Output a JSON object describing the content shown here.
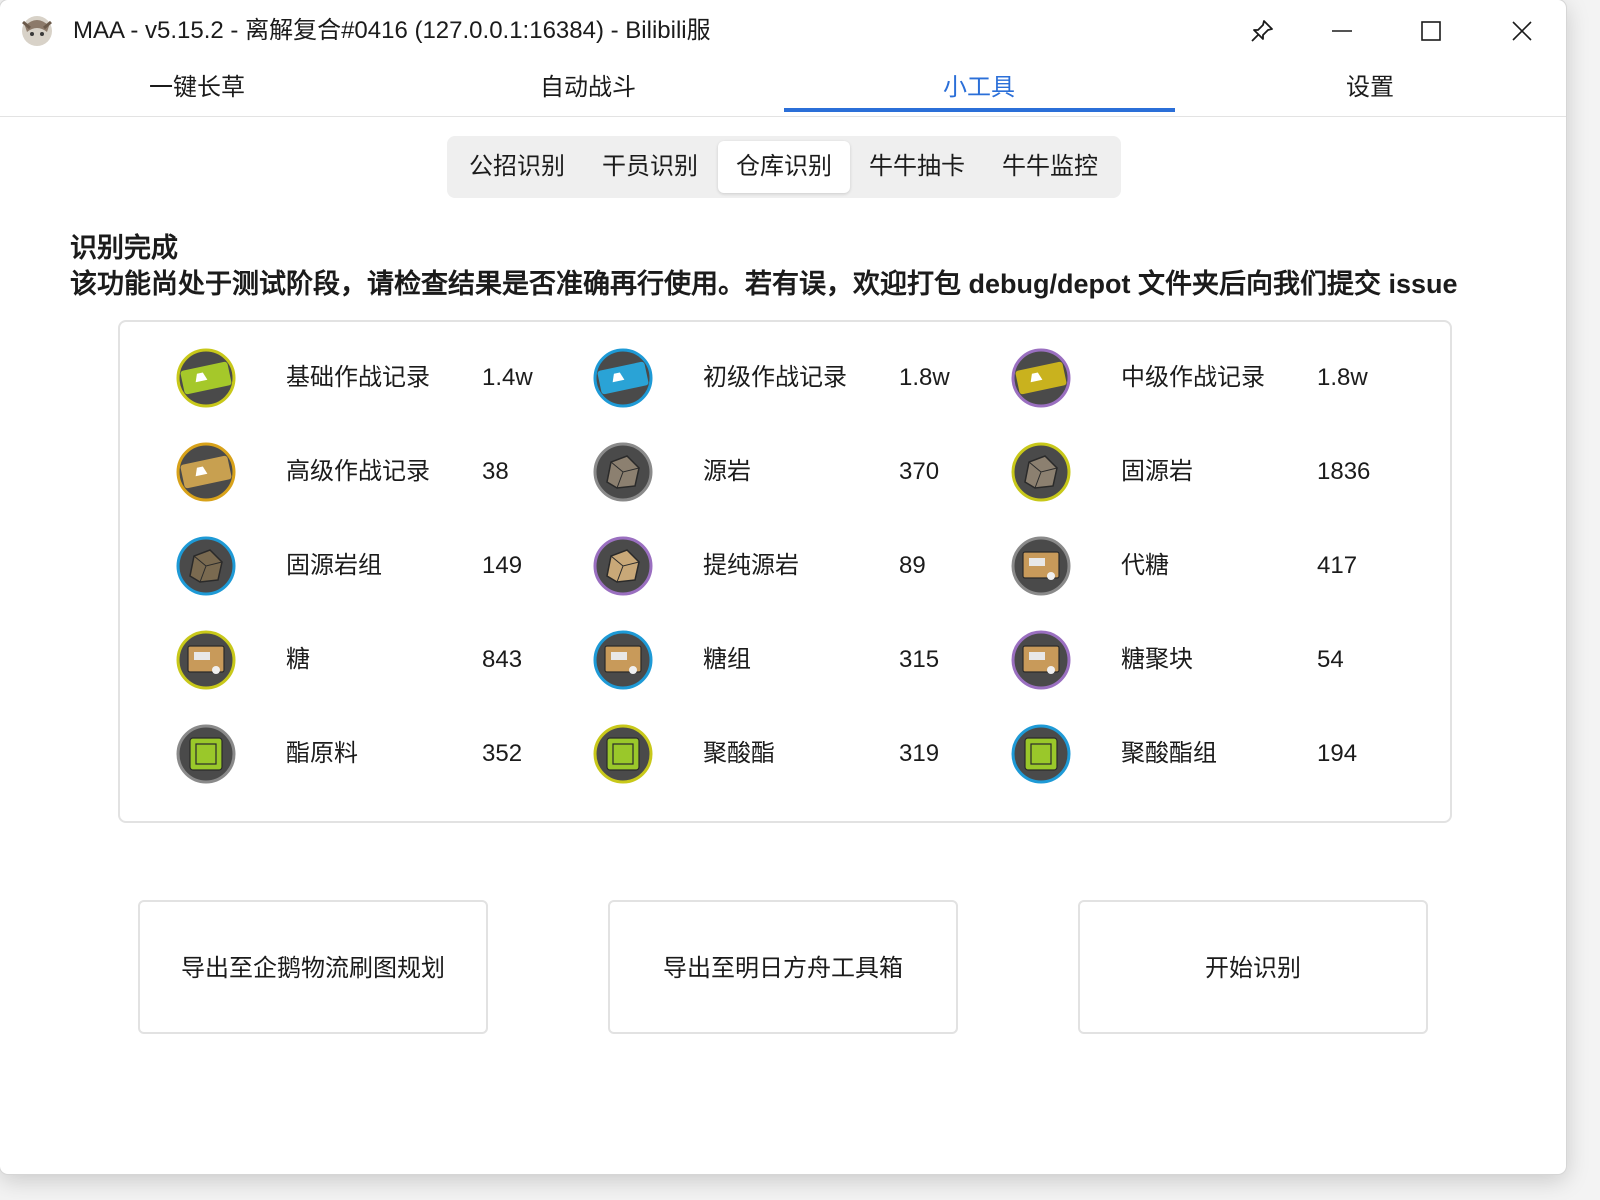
{
  "window": {
    "title": "MAA - v5.15.2 - 离解复合#0416 (127.0.0.1:16384) - Bilibili服",
    "app_icon": "maa-logo-icon",
    "controls": [
      "pin-icon",
      "minimize-icon",
      "maximize-icon",
      "close-icon"
    ]
  },
  "main_tabs": [
    {
      "label": "一键长草"
    },
    {
      "label": "自动战斗"
    },
    {
      "label": "小工具",
      "active": true
    },
    {
      "label": "设置"
    }
  ],
  "sub_tabs": [
    {
      "label": "公招识别"
    },
    {
      "label": "干员识别"
    },
    {
      "label": "仓库识别",
      "active": true
    },
    {
      "label": "牛牛抽卡"
    },
    {
      "label": "牛牛监控"
    }
  ],
  "status": {
    "line1": "识别完成",
    "line2": "该功能尚处于测试阶段，请检查结果是否准确再行使用。若有误，欢迎打包 debug/depot 文件夹后向我们提交 issue"
  },
  "items": [
    {
      "name": "基础作战记录",
      "count": "1.4w",
      "icon": "exp-card-green-icon",
      "rarity_color": "#c8c81a"
    },
    {
      "name": "初级作战记录",
      "count": "1.8w",
      "icon": "exp-card-blue-icon",
      "rarity_color": "#1e9ad6"
    },
    {
      "name": "中级作战记录",
      "count": "1.8w",
      "icon": "exp-card-yellow-icon",
      "rarity_color": "#9a6fc0"
    },
    {
      "name": "高级作战记录",
      "count": "38",
      "icon": "exp-card-gold-icon",
      "rarity_color": "#d8a21a"
    },
    {
      "name": "源岩",
      "count": "370",
      "icon": "rock-icon",
      "rarity_color": "#8a8a8a"
    },
    {
      "name": "固源岩",
      "count": "1836",
      "icon": "rock-icon",
      "rarity_color": "#c8c81a"
    },
    {
      "name": "固源岩组",
      "count": "149",
      "icon": "rock-group-icon",
      "rarity_color": "#1e9ad6"
    },
    {
      "name": "提纯源岩",
      "count": "89",
      "icon": "rock-pure-icon",
      "rarity_color": "#9a6fc0"
    },
    {
      "name": "代糖",
      "count": "417",
      "icon": "sugar-sub-icon",
      "rarity_color": "#8a8a8a"
    },
    {
      "name": "糖",
      "count": "843",
      "icon": "sugar-icon",
      "rarity_color": "#c8c81a"
    },
    {
      "name": "糖组",
      "count": "315",
      "icon": "sugar-pack-icon",
      "rarity_color": "#1e9ad6"
    },
    {
      "name": "糖聚块",
      "count": "54",
      "icon": "sugar-lump-icon",
      "rarity_color": "#9a6fc0"
    },
    {
      "name": "酯原料",
      "count": "352",
      "icon": "ester-icon",
      "rarity_color": "#8a8a8a"
    },
    {
      "name": "聚酸酯",
      "count": "319",
      "icon": "polyester-icon",
      "rarity_color": "#c8c81a"
    },
    {
      "name": "聚酸酯组",
      "count": "194",
      "icon": "polyester-pack-icon",
      "rarity_color": "#1e9ad6"
    }
  ],
  "actions": [
    {
      "label": "导出至企鹅物流刷图规划"
    },
    {
      "label": "导出至明日方舟工具箱"
    },
    {
      "label": "开始识别"
    }
  ],
  "colors": {
    "accent": "#2b6fd8",
    "window_bg": "#ffffff",
    "border": "#e2e2e2"
  }
}
